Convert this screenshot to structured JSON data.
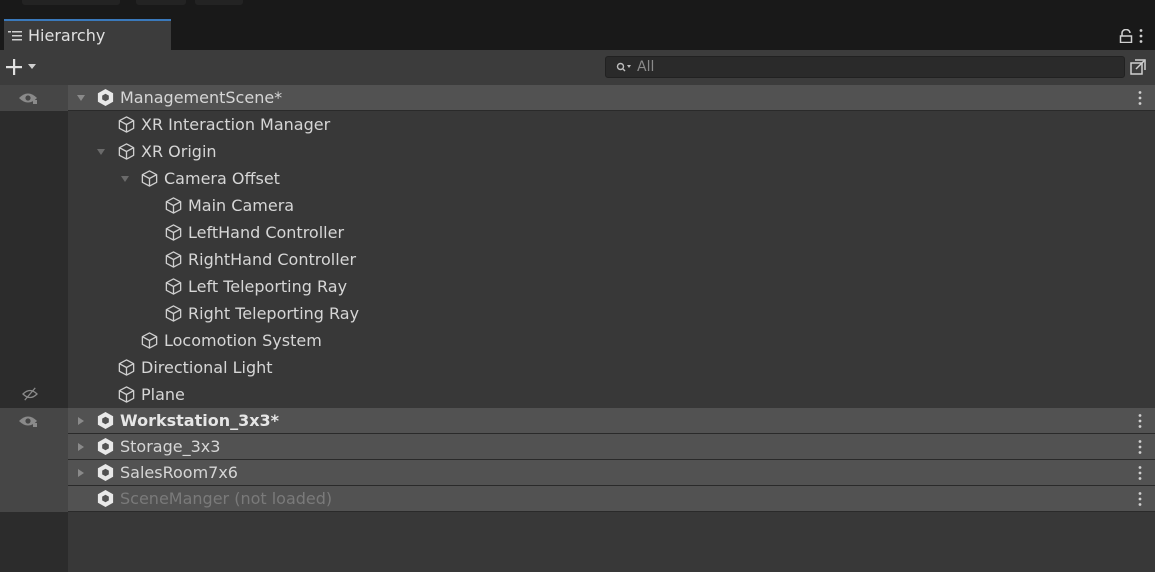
{
  "panel": {
    "tab_label": "Hierarchy",
    "search_placeholder": "All"
  },
  "colors": {
    "accent": "#3a79bb",
    "panel_bg": "#383838",
    "scene_row_bg": "#525252"
  },
  "rows": [
    {
      "label": "ManagementScene*",
      "kind": "scene",
      "expanded": true,
      "visibility": "visible",
      "icon": "unity-scene-icon"
    },
    {
      "label": "XR Interaction Manager",
      "kind": "object",
      "icon": "cube-icon"
    },
    {
      "label": "XR Origin",
      "kind": "object",
      "expanded": true,
      "icon": "cube-icon"
    },
    {
      "label": "Camera Offset",
      "kind": "object",
      "expanded": true,
      "icon": "cube-icon"
    },
    {
      "label": "Main Camera",
      "kind": "object",
      "icon": "cube-icon"
    },
    {
      "label": "LeftHand Controller",
      "kind": "object",
      "icon": "cube-icon"
    },
    {
      "label": "RightHand Controller",
      "kind": "object",
      "icon": "cube-icon"
    },
    {
      "label": "Left Teleporting Ray",
      "kind": "object",
      "icon": "cube-icon"
    },
    {
      "label": "Right Teleporting Ray",
      "kind": "object",
      "icon": "cube-icon"
    },
    {
      "label": "Locomotion System",
      "kind": "object",
      "icon": "cube-icon"
    },
    {
      "label": "Directional Light",
      "kind": "object",
      "icon": "cube-icon"
    },
    {
      "label": "Plane",
      "kind": "object",
      "visibility": "hidden",
      "icon": "cube-icon"
    },
    {
      "label": "Workstation_3x3*",
      "kind": "scene",
      "expanded": false,
      "visibility": "visible",
      "icon": "unity-scene-icon"
    },
    {
      "label": "Storage_3x3",
      "kind": "scene",
      "expanded": false,
      "icon": "unity-scene-icon"
    },
    {
      "label": "SalesRoom7x6",
      "kind": "scene",
      "expanded": false,
      "icon": "unity-scene-icon"
    },
    {
      "label": "SceneManger (not loaded)",
      "kind": "scene",
      "loaded": false,
      "icon": "unity-scene-icon"
    }
  ]
}
